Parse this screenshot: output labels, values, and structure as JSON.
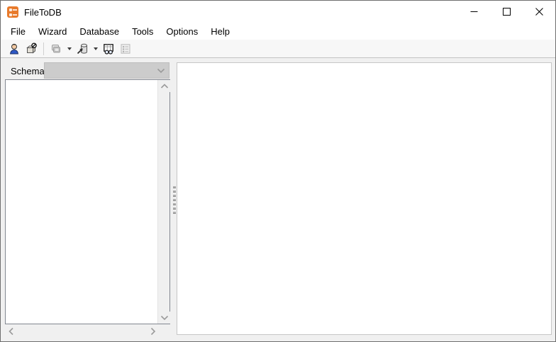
{
  "window": {
    "title": "FileToDB",
    "controls": {
      "minimize": "minimize",
      "maximize": "maximize",
      "close": "close"
    }
  },
  "menu": {
    "items": [
      "File",
      "Wizard",
      "Database",
      "Tools",
      "Options",
      "Help"
    ]
  },
  "toolbar": {
    "buttons": [
      {
        "name": "connect",
        "icon": "connect-user-icon",
        "enabled": true
      },
      {
        "name": "disconnect",
        "icon": "disconnect-icon",
        "enabled": true
      },
      {
        "name": "cascade-windows",
        "icon": "cascade-windows-icon",
        "enabled": false,
        "has_dropdown": true
      },
      {
        "name": "import-to-database",
        "icon": "import-to-database-icon",
        "enabled": true,
        "has_dropdown": true
      },
      {
        "name": "browse-data",
        "icon": "browse-data-icon",
        "enabled": true
      },
      {
        "name": "details-list",
        "icon": "details-list-icon",
        "enabled": false
      }
    ]
  },
  "sidebar": {
    "schema_label": "Schema",
    "schema_value": "",
    "list_items": []
  },
  "main_panel": {
    "content": ""
  },
  "colors": {
    "accent_orange": "#E87A2B",
    "window_border": "#6E6E6E",
    "chrome_bg": "#FFFFFF",
    "content_bg": "#F0F0F0",
    "disabled_combo_fill": "#CCCCCC",
    "listbox_border": "#828790"
  }
}
